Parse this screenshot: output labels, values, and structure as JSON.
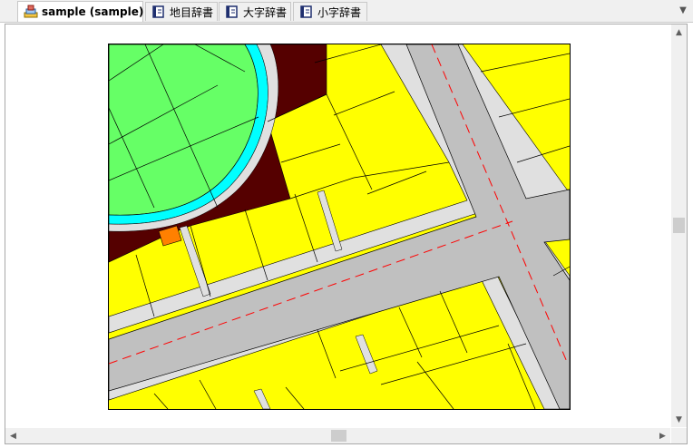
{
  "tabs": [
    {
      "label": "sample (sample)",
      "icon": "layers-icon",
      "active": true,
      "close": "×"
    },
    {
      "label": "地目辞書",
      "icon": "book-icon",
      "active": false
    },
    {
      "label": "大字辞書",
      "icon": "book-icon",
      "active": false
    },
    {
      "label": "小字辞書",
      "icon": "book-icon",
      "active": false
    }
  ],
  "overflow_button": "▼",
  "scroll": {
    "up": "▲",
    "down": "▼",
    "left": "◀",
    "right": "▶",
    "vertical_position": 0.5,
    "horizontal_position": 0.5
  },
  "colors": {
    "park": "#66ff66",
    "water": "#00ffff",
    "dark_lot": "#550000",
    "lot": "#ffff00",
    "road": "#c0c0c0",
    "sidewalk": "#e0e0e0",
    "centerline": "#ff0000",
    "orange_lot": "#ff8000"
  }
}
